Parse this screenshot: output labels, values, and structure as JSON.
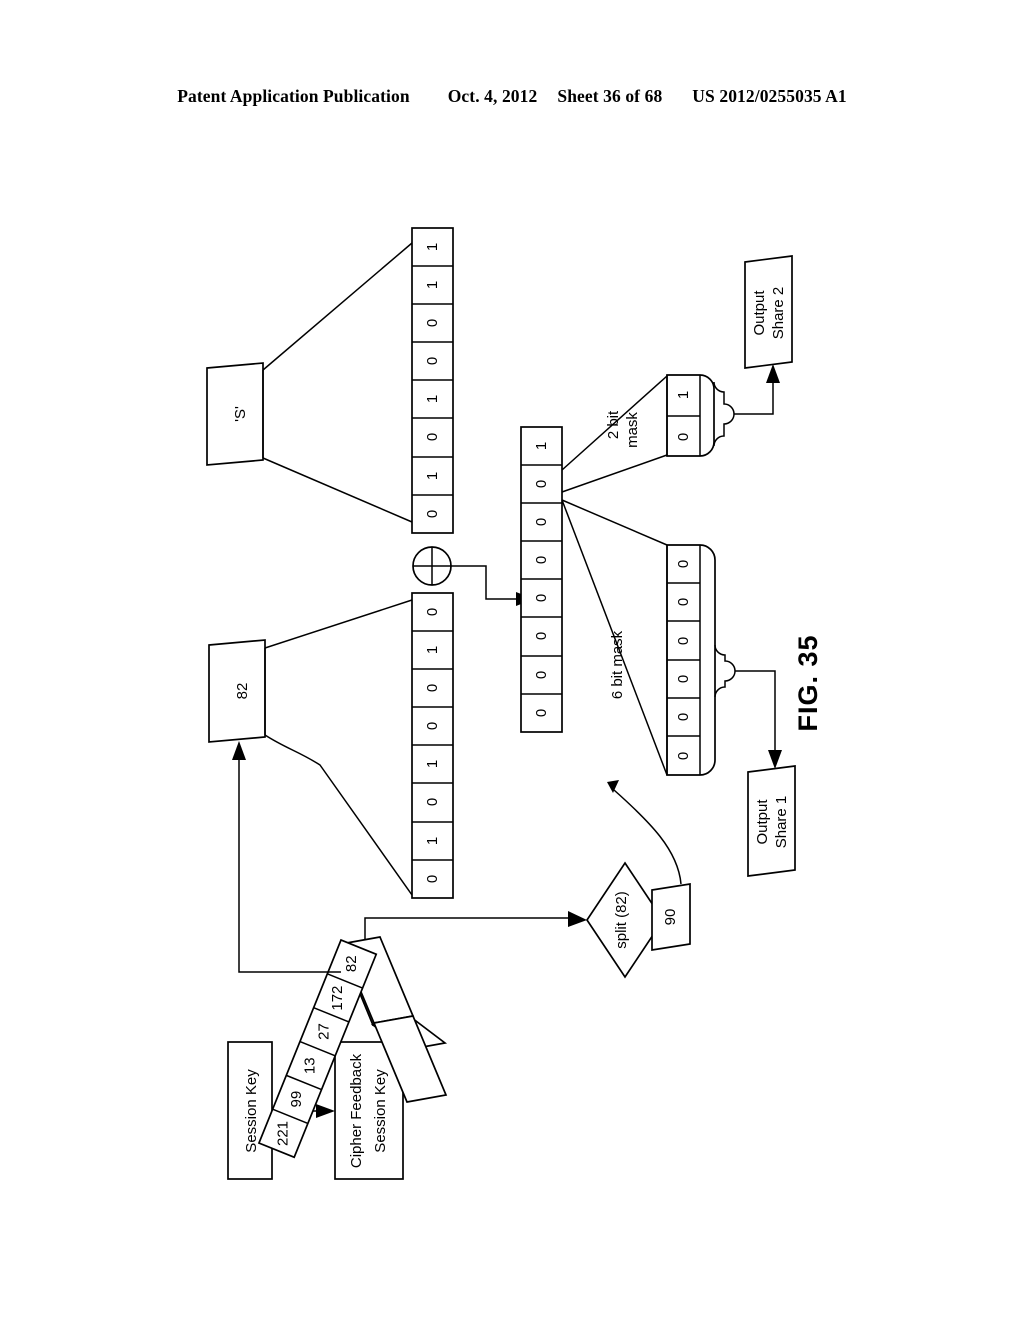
{
  "header": {
    "publication": "Patent Application Publication",
    "date": "Oct. 4, 2012",
    "sheet": "Sheet 36 of 68",
    "number": "US 2012/0255035 A1"
  },
  "figure": {
    "label": "FIG. 35",
    "plaintext_source": {
      "name": "plaintext-char",
      "label": "'S'"
    },
    "plaintext_bits": {
      "name": "plaintext-bit-array",
      "bits": [
        "1",
        "1",
        "0",
        "0",
        "1",
        "0",
        "1",
        "0"
      ]
    },
    "key_byte_source": {
      "name": "key-byte-value",
      "label": "82"
    },
    "key_bits": {
      "name": "key-bit-array",
      "bits": [
        "0",
        "1",
        "0",
        "0",
        "1",
        "0",
        "1",
        "0"
      ]
    },
    "xor": {
      "name": "xor-operator",
      "symbol": "⊕"
    },
    "xor_result": {
      "name": "xor-result-array",
      "bits": [
        "1",
        "0",
        "0",
        "0",
        "0",
        "0",
        "0",
        "0"
      ]
    },
    "two_bit_mask": {
      "name": "two-bit-mask",
      "label": "2 bit mask",
      "bits": [
        "1",
        "0"
      ]
    },
    "six_bit_mask": {
      "name": "six-bit-mask",
      "label": "6 bit mask",
      "bits": [
        "0",
        "0",
        "0",
        "0",
        "0",
        "0"
      ]
    },
    "output_share_2": {
      "name": "output-share-2",
      "line1": "Output",
      "line2": "Share 2"
    },
    "output_share_1": {
      "name": "output-share-1",
      "line1": "Output",
      "line2": "Share 1"
    },
    "split_node": {
      "name": "split-decision",
      "label": "split (82)"
    },
    "split_result": {
      "name": "split-result-value",
      "label": "90"
    },
    "session_key": {
      "name": "session-key-box",
      "label": "Session Key"
    },
    "cipher_feedback_session_key": {
      "name": "cipher-feedback-session-key-box",
      "line1": "Cipher Feedback",
      "line2": "Session Key"
    },
    "key_stream": {
      "name": "key-stream-array",
      "values": [
        "82",
        "172",
        "27",
        "13",
        "99",
        "221"
      ]
    }
  }
}
